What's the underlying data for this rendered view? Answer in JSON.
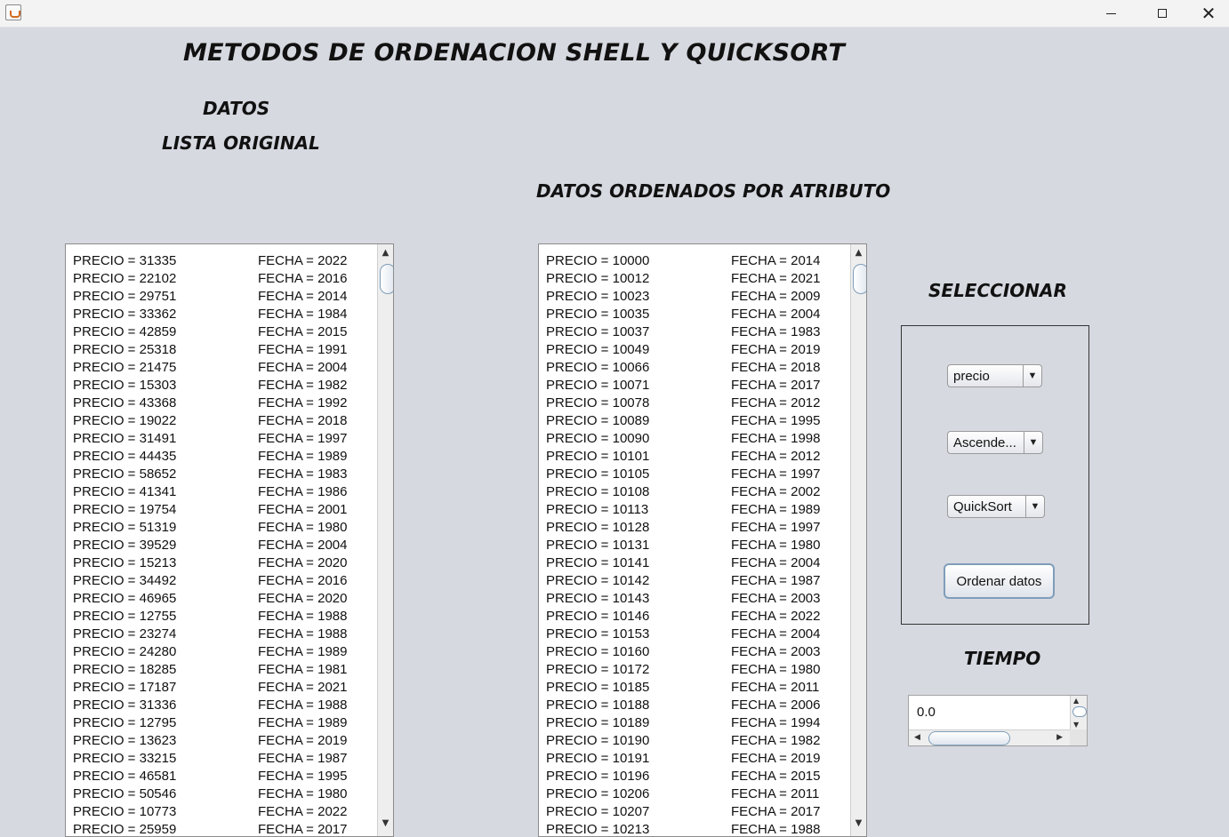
{
  "window": {
    "title_icon": "java-app-icon",
    "controls": {
      "minimize": "minimize-icon",
      "maximize": "maximize-icon",
      "close": "close-icon"
    }
  },
  "headings": {
    "main": "METODOS DE ORDENACION SHELL Y QUICKSORT",
    "datos": "DATOS",
    "lista_original": "LISTA ORIGINAL",
    "ordenados": "DATOS ORDENADOS POR ATRIBUTO",
    "seleccionar": "SELECCIONAR",
    "tiempo": "TIEMPO"
  },
  "original_list": [
    {
      "precio": "PRECIO = 31335",
      "fecha": "FECHA = 2022"
    },
    {
      "precio": "PRECIO = 22102",
      "fecha": "FECHA = 2016"
    },
    {
      "precio": "PRECIO = 29751",
      "fecha": "FECHA = 2014"
    },
    {
      "precio": "PRECIO = 33362",
      "fecha": "FECHA = 1984"
    },
    {
      "precio": "PRECIO = 42859",
      "fecha": "FECHA = 2015"
    },
    {
      "precio": "PRECIO = 25318",
      "fecha": "FECHA = 1991"
    },
    {
      "precio": "PRECIO = 21475",
      "fecha": "FECHA = 2004"
    },
    {
      "precio": "PRECIO = 15303",
      "fecha": "FECHA = 1982"
    },
    {
      "precio": "PRECIO = 43368",
      "fecha": "FECHA = 1992"
    },
    {
      "precio": "PRECIO = 19022",
      "fecha": "FECHA = 2018"
    },
    {
      "precio": "PRECIO = 31491",
      "fecha": "FECHA = 1997"
    },
    {
      "precio": "PRECIO = 44435",
      "fecha": "FECHA = 1989"
    },
    {
      "precio": "PRECIO = 58652",
      "fecha": "FECHA = 1983"
    },
    {
      "precio": "PRECIO = 41341",
      "fecha": "FECHA = 1986"
    },
    {
      "precio": "PRECIO = 19754",
      "fecha": "FECHA = 2001"
    },
    {
      "precio": "PRECIO = 51319",
      "fecha": "FECHA = 1980"
    },
    {
      "precio": "PRECIO = 39529",
      "fecha": "FECHA = 2004"
    },
    {
      "precio": "PRECIO = 15213",
      "fecha": "FECHA = 2020"
    },
    {
      "precio": "PRECIO = 34492",
      "fecha": "FECHA = 2016"
    },
    {
      "precio": "PRECIO = 46965",
      "fecha": "FECHA = 2020"
    },
    {
      "precio": "PRECIO = 12755",
      "fecha": "FECHA = 1988"
    },
    {
      "precio": "PRECIO = 23274",
      "fecha": "FECHA = 1988"
    },
    {
      "precio": "PRECIO = 24280",
      "fecha": "FECHA = 1989"
    },
    {
      "precio": "PRECIO = 18285",
      "fecha": "FECHA = 1981"
    },
    {
      "precio": "PRECIO = 17187",
      "fecha": "FECHA = 2021"
    },
    {
      "precio": "PRECIO = 31336",
      "fecha": "FECHA = 1988"
    },
    {
      "precio": "PRECIO = 12795",
      "fecha": "FECHA = 1989"
    },
    {
      "precio": "PRECIO = 13623",
      "fecha": "FECHA = 2019"
    },
    {
      "precio": "PRECIO = 33215",
      "fecha": "FECHA = 1987"
    },
    {
      "precio": "PRECIO = 46581",
      "fecha": "FECHA = 1995"
    },
    {
      "precio": "PRECIO = 50546",
      "fecha": "FECHA = 1980"
    },
    {
      "precio": "PRECIO = 10773",
      "fecha": "FECHA = 2022"
    },
    {
      "precio": "PRECIO = 25959",
      "fecha": "FECHA = 2017"
    }
  ],
  "sorted_list": [
    {
      "precio": "PRECIO = 10000",
      "fecha": "FECHA = 2014"
    },
    {
      "precio": "PRECIO = 10012",
      "fecha": "FECHA = 2021"
    },
    {
      "precio": "PRECIO = 10023",
      "fecha": "FECHA = 2009"
    },
    {
      "precio": "PRECIO = 10035",
      "fecha": "FECHA = 2004"
    },
    {
      "precio": "PRECIO = 10037",
      "fecha": "FECHA = 1983"
    },
    {
      "precio": "PRECIO = 10049",
      "fecha": "FECHA = 2019"
    },
    {
      "precio": "PRECIO = 10066",
      "fecha": "FECHA = 2018"
    },
    {
      "precio": "PRECIO = 10071",
      "fecha": "FECHA = 2017"
    },
    {
      "precio": "PRECIO = 10078",
      "fecha": "FECHA = 2012"
    },
    {
      "precio": "PRECIO = 10089",
      "fecha": "FECHA = 1995"
    },
    {
      "precio": "PRECIO = 10090",
      "fecha": "FECHA = 1998"
    },
    {
      "precio": "PRECIO = 10101",
      "fecha": "FECHA = 2012"
    },
    {
      "precio": "PRECIO = 10105",
      "fecha": "FECHA = 1997"
    },
    {
      "precio": "PRECIO = 10108",
      "fecha": "FECHA = 2002"
    },
    {
      "precio": "PRECIO = 10113",
      "fecha": "FECHA = 1989"
    },
    {
      "precio": "PRECIO = 10128",
      "fecha": "FECHA = 1997"
    },
    {
      "precio": "PRECIO = 10131",
      "fecha": "FECHA = 1980"
    },
    {
      "precio": "PRECIO = 10141",
      "fecha": "FECHA = 2004"
    },
    {
      "precio": "PRECIO = 10142",
      "fecha": "FECHA = 1987"
    },
    {
      "precio": "PRECIO = 10143",
      "fecha": "FECHA = 2003"
    },
    {
      "precio": "PRECIO = 10146",
      "fecha": "FECHA = 2022"
    },
    {
      "precio": "PRECIO = 10153",
      "fecha": "FECHA = 2004"
    },
    {
      "precio": "PRECIO = 10160",
      "fecha": "FECHA = 2003"
    },
    {
      "precio": "PRECIO = 10172",
      "fecha": "FECHA = 1980"
    },
    {
      "precio": "PRECIO = 10185",
      "fecha": "FECHA = 2011"
    },
    {
      "precio": "PRECIO = 10188",
      "fecha": "FECHA = 2006"
    },
    {
      "precio": "PRECIO = 10189",
      "fecha": "FECHA = 1994"
    },
    {
      "precio": "PRECIO = 10190",
      "fecha": "FECHA = 1982"
    },
    {
      "precio": "PRECIO = 10191",
      "fecha": "FECHA = 2019"
    },
    {
      "precio": "PRECIO = 10196",
      "fecha": "FECHA = 2015"
    },
    {
      "precio": "PRECIO = 10206",
      "fecha": "FECHA = 2011"
    },
    {
      "precio": "PRECIO = 10207",
      "fecha": "FECHA = 2017"
    },
    {
      "precio": "PRECIO = 10213",
      "fecha": "FECHA = 1988"
    }
  ],
  "controls": {
    "atributo": "precio",
    "orden": "Ascende...",
    "metodo": "QuickSort",
    "ordenar_button": "Ordenar datos",
    "dropdown_icon": "chevron-down-icon"
  },
  "tiempo_value": "0.0",
  "colors": {
    "background": "#d6d9e0",
    "titlebar": "#f3f3f3",
    "list_background": "#ffffff",
    "scroll_thumb_border": "#7f9db9"
  }
}
